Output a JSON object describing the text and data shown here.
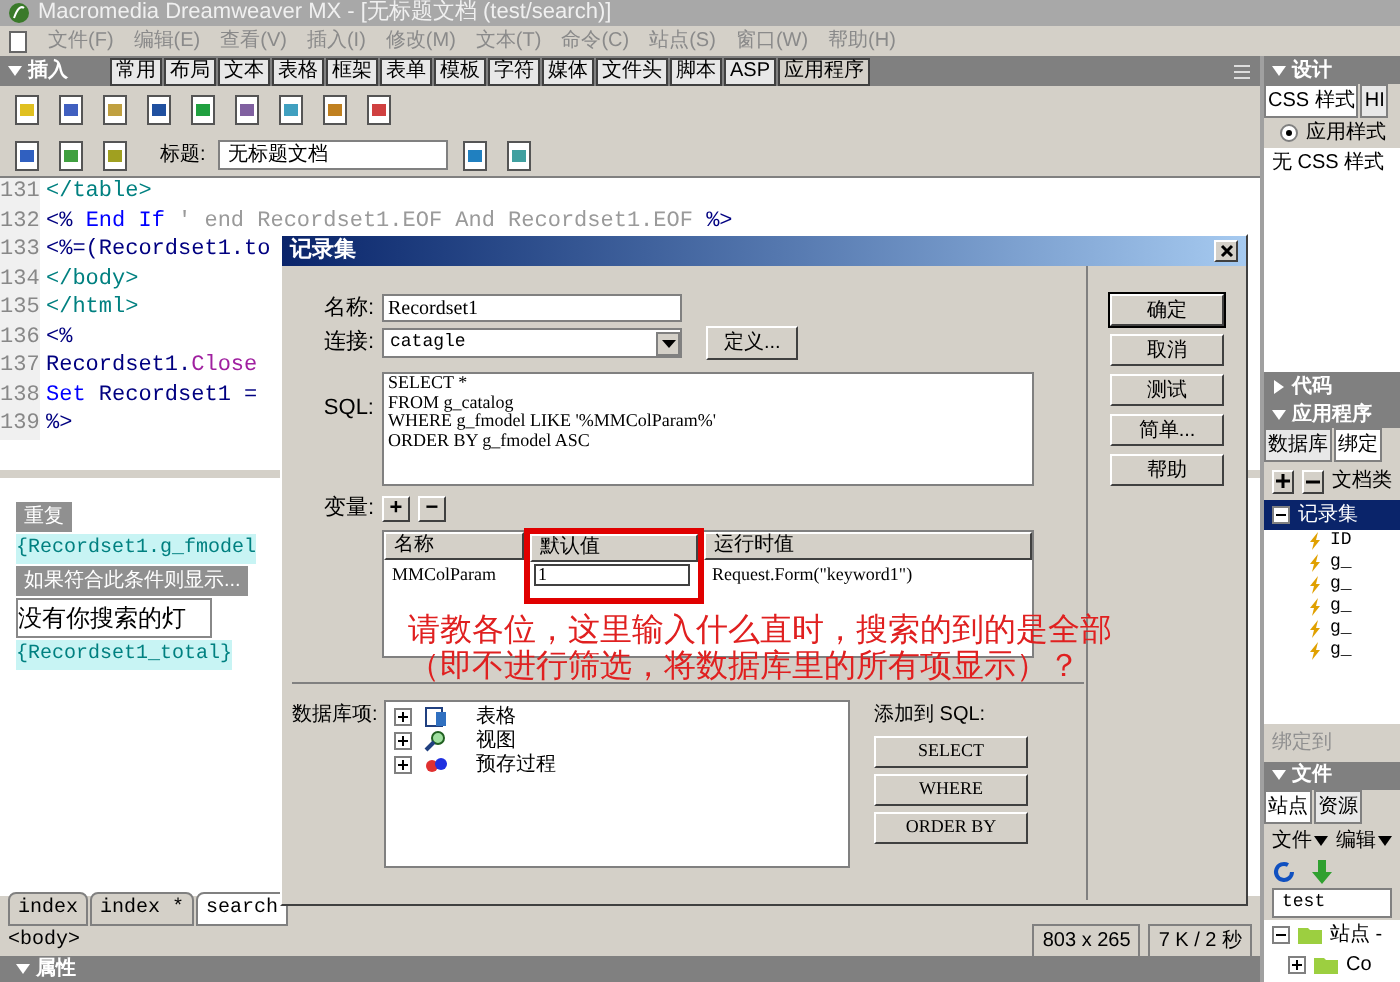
{
  "window": {
    "title": "Macromedia Dreamweaver MX - [无标题文档 (test/search)]"
  },
  "menu": [
    "文件(F)",
    "编辑(E)",
    "查看(V)",
    "插入(I)",
    "修改(M)",
    "文本(T)",
    "命令(C)",
    "站点(S)",
    "窗口(W)",
    "帮助(H)"
  ],
  "insert_panel": {
    "title": "插入",
    "tabs": [
      {
        "label": "常用",
        "selected": false
      },
      {
        "label": "布局",
        "selected": false
      },
      {
        "label": "文本",
        "selected": false
      },
      {
        "label": "表格",
        "selected": false
      },
      {
        "label": "框架",
        "selected": false
      },
      {
        "label": "表单",
        "selected": false
      },
      {
        "label": "模板",
        "selected": false
      },
      {
        "label": "字符",
        "selected": false
      },
      {
        "label": "媒体",
        "selected": false
      },
      {
        "label": "文件头",
        "selected": false
      },
      {
        "label": "脚本",
        "selected": false
      },
      {
        "label": "ASP",
        "selected": false
      },
      {
        "label": "应用程序",
        "selected": true
      }
    ]
  },
  "document_toolbar": {
    "title_label": "标题:",
    "title_value": "无标题文档"
  },
  "code_lines": [
    {
      "number": "131",
      "parts": [
        {
          "kind": "tag",
          "text": "</table>"
        }
      ]
    },
    {
      "number": "132",
      "parts": [
        {
          "kind": "asp",
          "text": "<% "
        },
        {
          "kind": "keyword",
          "text": "End If"
        },
        {
          "kind": "comment",
          "text": " ' end Recordset1.EOF And Recordset1.EOF"
        },
        {
          "kind": "asp",
          "text": " %>"
        }
      ]
    },
    {
      "number": "133",
      "parts": [
        {
          "kind": "asp",
          "text": "<%=(Recordset1.to"
        }
      ]
    },
    {
      "number": "134",
      "parts": [
        {
          "kind": "tag",
          "text": "</body>"
        }
      ]
    },
    {
      "number": "135",
      "parts": [
        {
          "kind": "tag",
          "text": "</html>"
        }
      ]
    },
    {
      "number": "136",
      "parts": [
        {
          "kind": "asp",
          "text": "<%"
        }
      ]
    },
    {
      "number": "137",
      "parts": [
        {
          "kind": "plain",
          "text": "Recordset1."
        },
        {
          "kind": "method",
          "text": "Close"
        }
      ]
    },
    {
      "number": "138",
      "parts": [
        {
          "kind": "keyword",
          "text": "Set"
        },
        {
          "kind": "plain",
          "text": " Recordset1 ="
        }
      ]
    },
    {
      "number": "139",
      "parts": [
        {
          "kind": "asp",
          "text": "%>"
        }
      ]
    }
  ],
  "design_view": [
    {
      "kind": "label",
      "text": "重复"
    },
    {
      "kind": "binding",
      "text": "{Recordset1.g_fmodel"
    },
    {
      "kind": "label",
      "text": "如果符合此条件则显示..."
    },
    {
      "kind": "plain",
      "text": "没有你搜索的灯"
    },
    {
      "kind": "binding",
      "text": "{Recordset1_total}"
    }
  ],
  "document_tabs": [
    {
      "label": "index",
      "selected": false
    },
    {
      "label": "index *",
      "selected": false
    },
    {
      "label": "search",
      "selected": true
    }
  ],
  "status_bar": {
    "tag": "<body>",
    "size": "803 x 265",
    "download": "7 K / 2 秒"
  },
  "properties_panel": {
    "title": "属性"
  },
  "dialog": {
    "title": "记录集",
    "name_label": "名称:",
    "name_value": "Recordset1",
    "connection_label": "连接:",
    "connection_value": "catagle",
    "define_button": "定义...",
    "sql_label": "SQL:",
    "sql_lines": [
      "SELECT *",
      "FROM g_catalog",
      "WHERE g_fmodel LIKE '%MMColParam%'",
      "ORDER BY g_fmodel ASC"
    ],
    "variables_label": "变量:",
    "add_button": "+",
    "remove_button": "−",
    "variables_columns": [
      "名称",
      "默认值",
      "运行时值"
    ],
    "variables_rows": [
      {
        "name": "MMColParam",
        "default": "1",
        "runtime": "Request.Form(\"keyword1\")"
      }
    ],
    "db_items_label": "数据库项:",
    "db_items": [
      {
        "label": "表格",
        "kind": "table",
        "expanded": false
      },
      {
        "label": "视图",
        "kind": "view",
        "expanded": false
      },
      {
        "label": "预存过程",
        "kind": "procedure",
        "expanded": false
      }
    ],
    "add_to_sql_label": "添加到 SQL:",
    "add_to_sql_buttons": [
      "SELECT",
      "WHERE",
      "ORDER BY"
    ],
    "side_buttons": [
      "确定",
      "取消",
      "测试",
      "简单...",
      "帮助"
    ]
  },
  "annotation": [
    "请教各位，这里输入什么直时，搜索的到的是全部",
    "（即不进行筛选，将数据库里的所有项显示）？"
  ],
  "right_panel": {
    "design_title": "设计",
    "design_tabs": [
      {
        "label": "CSS 样式",
        "selected": true
      },
      {
        "label": "HI",
        "selected": false
      }
    ],
    "apply_styles": {
      "label": "应用样式",
      "checked": true
    },
    "no_css": "无 CSS 样式",
    "code_title": "代码",
    "app_title": "应用程序",
    "app_tabs": [
      {
        "label": "数据库",
        "selected": false
      },
      {
        "label": "绑定",
        "selected": true
      }
    ],
    "doc_type": "文档类",
    "recordset": {
      "label": "记录集",
      "expanded": true,
      "children": [
        "ID",
        "g_",
        "g_",
        "g_",
        "g_",
        "g_"
      ]
    },
    "bind_to": "绑定到",
    "files_title": "文件",
    "files_tabs": [
      {
        "label": "站点",
        "selected": true
      },
      {
        "label": "资源",
        "selected": false
      }
    ],
    "files_menus": [
      "文件",
      "编辑"
    ],
    "site_value": "test",
    "site_tree": {
      "label": "站点 -",
      "expanded": true,
      "children": [
        {
          "label": "Co",
          "expanded": false
        }
      ]
    }
  }
}
